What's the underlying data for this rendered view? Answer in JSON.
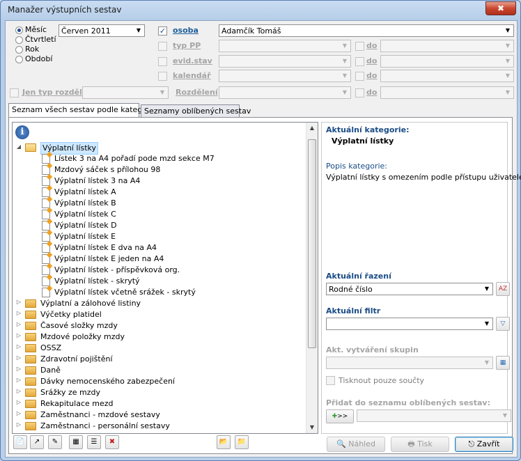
{
  "window": {
    "title": "Manažer výstupních sestav",
    "close_label": "✖"
  },
  "period": {
    "options": [
      "Měsíc",
      "Čtvrtletí",
      "Rok",
      "Období"
    ],
    "selected_index": 0,
    "month_value": "Červen 2011"
  },
  "filters": {
    "osoba": {
      "label": "osoba",
      "checked": true,
      "value": "Adamčík Tomáš"
    },
    "typ_pp": {
      "label": "typ PP",
      "to_label": "do"
    },
    "evid_stav": {
      "label": "evid.stav",
      "to_label": "do"
    },
    "kalendar": {
      "label": "kalendář",
      "to_label": "do"
    },
    "jen_typ": {
      "label": "Jen typ rozděl.",
      "rozdeleni_label": "Rozdělení",
      "to_label": "do"
    }
  },
  "tabs": [
    "Seznam všech sestav podle kategorií",
    "Seznamy oblíbených sestav"
  ],
  "tree": {
    "open_folder": "Výplatní lístky",
    "children": [
      "Lístek 3 na A4 pořadí pode mzd sekce M7",
      "Mzdový sáček s přílohou 98",
      "Výplatní lístek 3 na A4",
      "Výplatní lístek A",
      "Výplatní lístek B",
      "Výplatní lístek C",
      "Výplatní lístek D",
      "Výplatní lístek E",
      "Výplatní lístek E dva na A4",
      "Výplatní lístek E jeden na A4",
      "Výplatní lístek - příspěvková org.",
      "Výplatní lístek - skrytý",
      "Výplatní lístek včetně srážek - skrytý"
    ],
    "folders": [
      "Výplatní a zálohové listiny",
      "Výčetky platidel",
      "Časové složky mzdy",
      "Mzdové položky mzdy",
      "OSSZ",
      "Zdravotní pojištění",
      "Daně",
      "Dávky nemocenského zabezpečení",
      "Srážky ze mzdy",
      "Rekapitulace mezd",
      "Zaměstnanci - mzdové sestavy",
      "Zaměstnanci - personální sestavy"
    ]
  },
  "right": {
    "category_header": "Aktuální kategorie:",
    "category_value": "Výplatní lístky",
    "desc_header": "Popis kategorie:",
    "desc_value": "Výplatní lístky s omezením podle přístupu uživatele.",
    "sort_header": "Aktuální řazení",
    "sort_value": "Rodné číslo",
    "filter_header": "Aktuální filtr",
    "groups_header": "Akt. vytváření skupin",
    "sums_label": "Tisknout pouze součty",
    "favorites_header": "Přidat do seznamu oblíbených sestav:",
    "add_button": ">>"
  },
  "buttons": {
    "preview": "Náhled",
    "print": "Tisk",
    "close": "Zavřít"
  },
  "colors": {
    "accent": "#1a4c86",
    "link": "#1b5d9a",
    "disabled": "#a5a5a5"
  }
}
